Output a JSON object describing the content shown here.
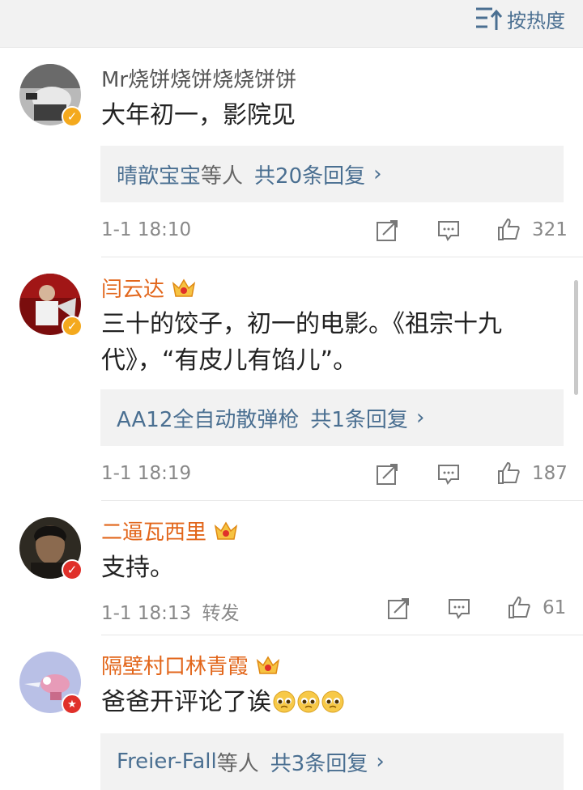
{
  "sort_label": "按热度",
  "colors": {
    "link": "#4a6f91",
    "orange_name": "#e2661b",
    "verified_gold": "#f4a91d",
    "verified_red": "#e0302a"
  },
  "comments": [
    {
      "username": "Mr烧饼烧饼烧烧饼饼",
      "text": "大年初一，影院见",
      "reply": {
        "names": "晴歆宝宝",
        "suffix": "等人",
        "count": "共20条回复"
      },
      "time": "1-1 18:10",
      "likes": "321"
    },
    {
      "username": "闫云达",
      "text_line1": "三十的饺子，初一的电影。《祖宗十九",
      "text_line2": "代》，“有皮儿有馅儿”。",
      "reply": {
        "names": "AA12全自动散弹枪",
        "suffix": "",
        "count": "共1条回复"
      },
      "time": "1-1 18:19",
      "likes": "187"
    },
    {
      "username": "二逼瓦西里",
      "text": "支持。",
      "time": "1-1 18:13",
      "forward": "转发",
      "likes": "61"
    },
    {
      "username": "隔壁村口林青霞",
      "text": "爸爸开评论了诶",
      "reply": {
        "names": "Freier-Fall",
        "suffix": "等人",
        "count": "共3条回复"
      }
    }
  ],
  "icons": [
    "sort-icon",
    "verified-icon",
    "vip-crown-icon",
    "repost-icon",
    "comment-icon",
    "like-icon",
    "chevron-right-icon",
    "pleading-emoji-icon"
  ]
}
